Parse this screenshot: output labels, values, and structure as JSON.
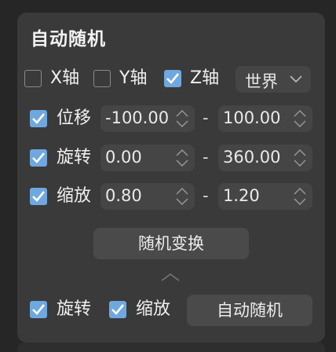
{
  "panel": {
    "title": "自动随机"
  },
  "axes": {
    "x": {
      "label": "X轴",
      "checked": false
    },
    "y": {
      "label": "Y轴",
      "checked": false
    },
    "z": {
      "label": "Z轴",
      "checked": true
    },
    "space_select": {
      "value": "世界"
    }
  },
  "rows": {
    "position": {
      "label": "位移",
      "checked": true,
      "min": "-100.00",
      "max": "100.00"
    },
    "rotation": {
      "label": "旋转",
      "checked": true,
      "min": "0.00",
      "max": "360.00"
    },
    "scale": {
      "label": "缩放",
      "checked": true,
      "min": "0.80",
      "max": "1.20"
    }
  },
  "range_separator": "-",
  "random_transform_button": "随机变换",
  "footer": {
    "rotation": {
      "label": "旋转",
      "checked": true
    },
    "scale": {
      "label": "缩放",
      "checked": true
    },
    "auto_random_button": "自动随机"
  },
  "colors": {
    "accent": "#6fa8de",
    "panel_bg": "#3a3a3a",
    "field_bg": "#454545",
    "page_bg": "#262626"
  },
  "icons": {
    "check": "check-icon",
    "dropdown": "chevron-down-icon",
    "spinner": "spinner-arrows-icon",
    "collapse": "chevron-up-icon"
  }
}
